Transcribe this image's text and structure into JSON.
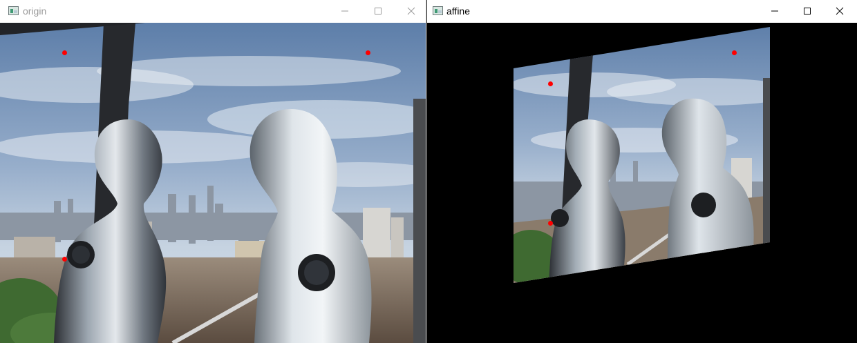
{
  "windows": [
    {
      "title": "origin",
      "icon": "opencv-window-icon",
      "controls": [
        "minimize-icon",
        "maximize-icon",
        "close-icon"
      ],
      "image": "city-skyline-with-glass-mannequins"
    },
    {
      "title": "affine",
      "icon": "opencv-window-icon",
      "controls": [
        "minimize-icon",
        "maximize-icon",
        "close-icon"
      ],
      "image": "affine-warped-city-skyline"
    }
  ],
  "marker_color": "#ff0000",
  "colors": {
    "sky_top": "#5d7ea9",
    "sky_bottom": "#d3dde7",
    "affine_background": "#000000",
    "title_inactive": "#9a9a9a",
    "title_active": "#000000"
  }
}
